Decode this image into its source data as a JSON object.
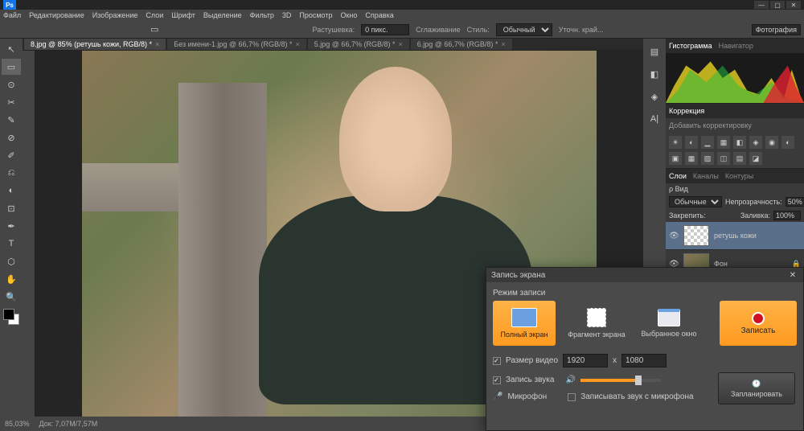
{
  "app": {
    "icon": "Ps"
  },
  "window": {
    "controls": [
      "—",
      "▢",
      "✕"
    ]
  },
  "menus": [
    "Файл",
    "Редактирование",
    "Изображение",
    "Слои",
    "Шрифт",
    "Выделение",
    "Фильтр",
    "3D",
    "Просмотр",
    "Окно",
    "Справка"
  ],
  "options": {
    "feather_label": "Растушевка:",
    "feather_value": "0 пикс.",
    "antialias": "Сглаживание",
    "style_label": "Стиль:",
    "style_value": "Обычный",
    "refine": "Уточн. край...",
    "workspace": "Фотография"
  },
  "tabs": [
    {
      "label": "8.jpg @ 85% (ретушь кожи, RGB/8) *",
      "active": true
    },
    {
      "label": "Без имени-1.jpg @ 66,7% (RGB/8) *",
      "active": false
    },
    {
      "label": "5.jpg @ 66,7% (RGB/8) *",
      "active": false
    },
    {
      "label": "6.jpg @ 66,7% (RGB/8) *",
      "active": false
    }
  ],
  "tools": [
    "↖",
    "▭",
    "⊙",
    "✂",
    "✎",
    "⊘",
    "✐",
    "⎌",
    "◐",
    "⊡",
    "✒",
    "T",
    "⬡",
    "✋",
    "🔍"
  ],
  "dock_icons": [
    "▤",
    "◧",
    "◈",
    "A|"
  ],
  "histogram": {
    "tabs": [
      "Гистограмма",
      "Навигатор"
    ]
  },
  "adjustments": {
    "tab": "Коррекция",
    "add_label": "Добавить корректировку",
    "icons": [
      "☀",
      "◐",
      "▁",
      "▦",
      "◧",
      "◈",
      "◉",
      "◐",
      "▣",
      "▦",
      "▨",
      "◫",
      "▤",
      "◪"
    ]
  },
  "layers": {
    "tabs": [
      "Слои",
      "Каналы",
      "Контуры"
    ],
    "kind_label": "ρ Вид",
    "blend_value": "Обычные",
    "opacity_label": "Непрозрачность:",
    "opacity_value": "50%",
    "lock_label": "Закрепить:",
    "fill_label": "Заливка:",
    "fill_value": "100%",
    "items": [
      {
        "name": "ретушь кожи",
        "active": true,
        "checker": true
      },
      {
        "name": "Фон",
        "active": false,
        "locked": true
      }
    ]
  },
  "status": {
    "zoom": "85,03%",
    "doc": "Док: 7,07M/7,57M"
  },
  "recorder": {
    "title": "Запись экрана",
    "mode_label": "Режим записи",
    "modes": [
      {
        "label": "Полный экран",
        "selected": true
      },
      {
        "label": "Фрагмент экрана",
        "selected": false
      },
      {
        "label": "Выбранное окно",
        "selected": false
      }
    ],
    "record_btn": "Записать",
    "size_label": "Размер видео",
    "width": "1920",
    "height": "1080",
    "x": "х",
    "audio_label": "Запись звука",
    "mic_label": "Микрофон",
    "mic_record": "Записывать звук с микрофона",
    "schedule_btn": "Запланировать"
  }
}
